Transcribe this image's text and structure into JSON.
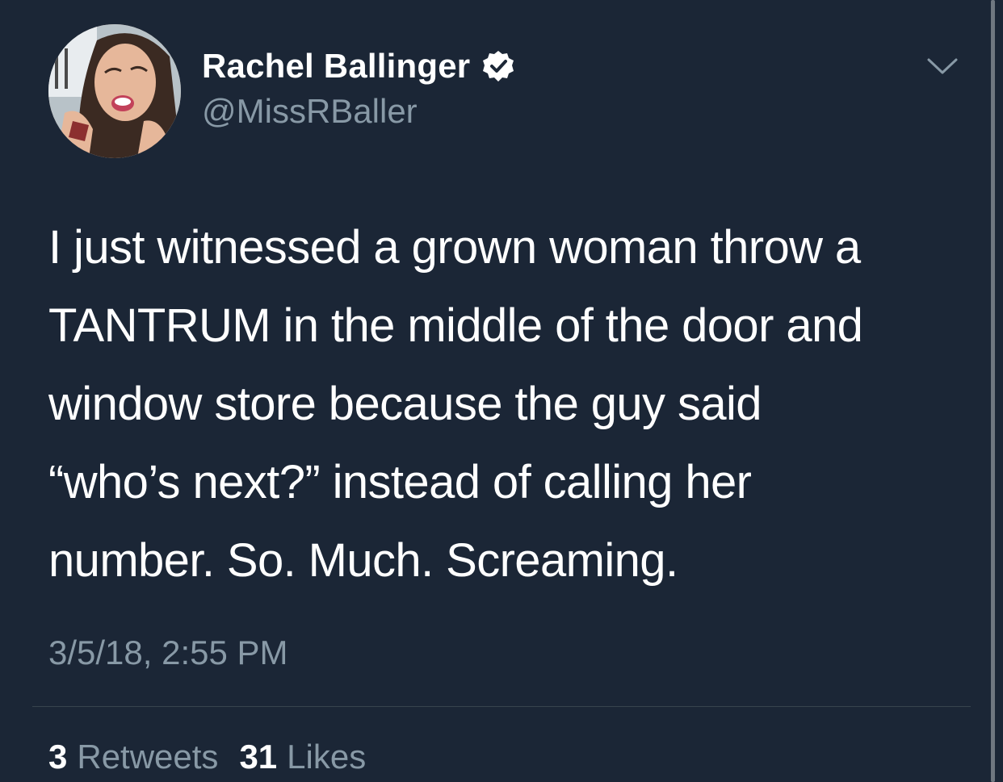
{
  "author": {
    "display_name": "Rachel Ballinger",
    "handle": "@MissRBaller",
    "verified": true,
    "avatar_icon": "profile-photo"
  },
  "tweet": {
    "text": "I just witnessed a grown woman throw a\nTANTRUM in the middle of the door and\nwindow store because the guy said\n“who’s next?” instead of calling her\nnumber. So. Much. Screaming.",
    "timestamp": "3/5/18, 2:55 PM"
  },
  "stats": {
    "retweets_count": "3",
    "retweets_label": "Retweets",
    "likes_count": "31",
    "likes_label": "Likes"
  },
  "colors": {
    "background": "#1b2636",
    "primary_text": "#ffffff",
    "secondary_text": "#8899a6",
    "divider": "#38444d"
  },
  "icons": {
    "verified": "verified-badge-icon",
    "menu": "chevron-down-icon"
  }
}
